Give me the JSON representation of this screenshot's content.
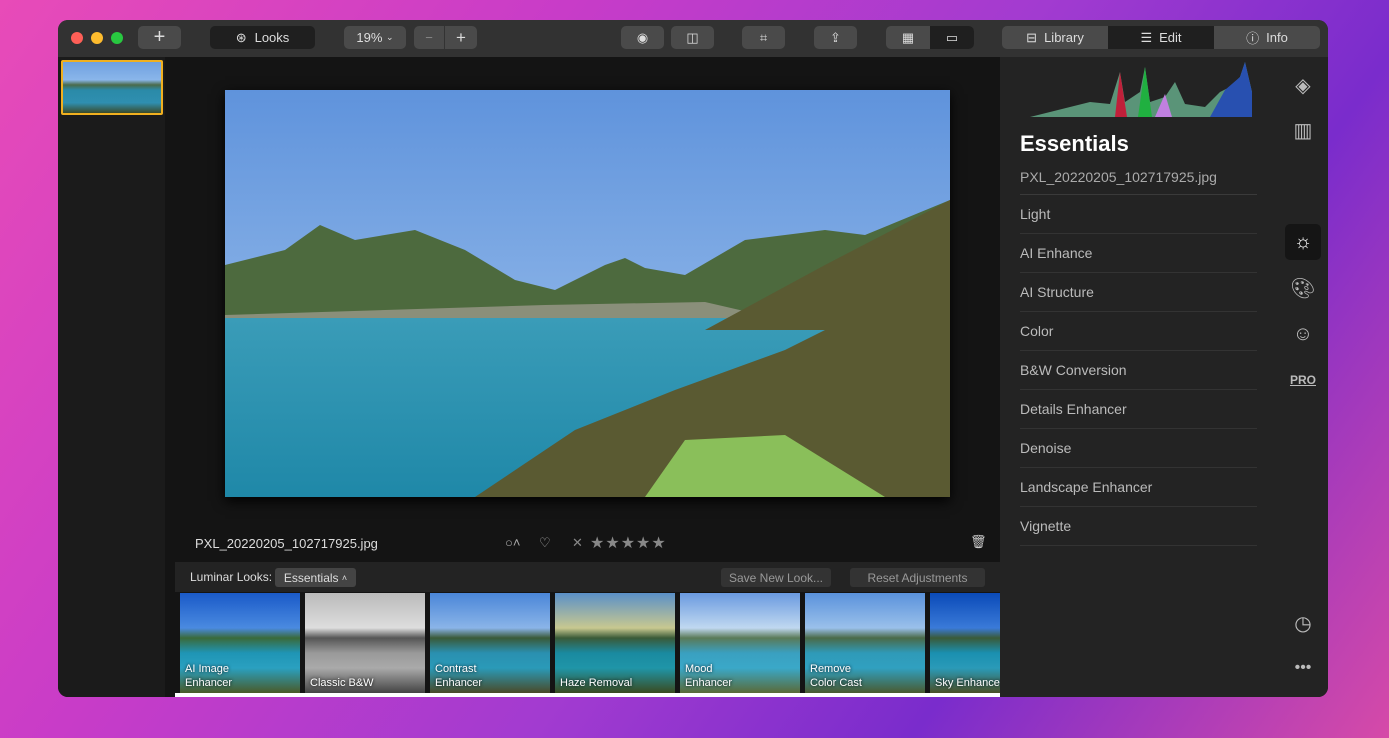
{
  "toolbar": {
    "looks_label": "Looks",
    "zoom_value": "19%",
    "tabs": [
      {
        "label": "Library"
      },
      {
        "label": "Edit"
      },
      {
        "label": "Info"
      }
    ],
    "active_tab": "Edit"
  },
  "panel": {
    "title": "Essentials",
    "filename": "PXL_20220205_102717925.jpg",
    "tools": [
      {
        "label": "Light"
      },
      {
        "label": "AI Enhance"
      },
      {
        "label": "AI Structure"
      },
      {
        "label": "Color"
      },
      {
        "label": "B&W Conversion"
      },
      {
        "label": "Details Enhancer"
      },
      {
        "label": "Denoise"
      },
      {
        "label": "Landscape Enhancer"
      },
      {
        "label": "Vignette"
      }
    ]
  },
  "image": {
    "filename": "PXL_20220205_102717925.jpg",
    "rating": 0,
    "max_rating": 5
  },
  "looksbar": {
    "label": "Luminar Looks:",
    "category": "Essentials",
    "save_label": "Save New Look...",
    "reset_label": "Reset Adjustments",
    "looks": [
      {
        "label": "AI Image\nEnhancer"
      },
      {
        "label": "Classic B&W"
      },
      {
        "label": "Contrast\nEnhancer"
      },
      {
        "label": "Haze Removal"
      },
      {
        "label": "Mood\nEnhancer"
      },
      {
        "label": "Remove\nColor Cast"
      },
      {
        "label": "Sky Enhancer"
      }
    ]
  },
  "side_icons": [
    "layers-icon",
    "ruler-icon",
    "sun-icon",
    "palette-icon",
    "face-icon",
    "pro-icon",
    "clock-icon",
    "more-icon"
  ],
  "colors": {
    "accent": "#f0b020",
    "background": "#1e1e1e"
  }
}
